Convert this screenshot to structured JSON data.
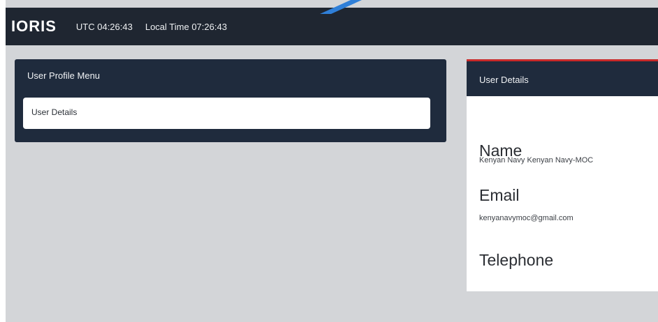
{
  "header": {
    "logo": "IORIS",
    "utc_time": "UTC 04:26:43",
    "local_time": "Local Time 07:26:43"
  },
  "user_profile_menu": {
    "title": "User Profile Menu",
    "items": [
      {
        "label": "User Details"
      }
    ]
  },
  "user_details": {
    "title": "User Details",
    "name_label": "Name",
    "name_value": "Kenyan Navy Kenyan Navy-MOC",
    "email_label": "Email",
    "email_value": "kenyanavymoc@gmail.com",
    "telephone_label": "Telephone"
  },
  "colors": {
    "topbar": "#1f2631",
    "panel_header": "#1f2b3d",
    "page_background": "#d3d5d8",
    "accent_red": "#c92a2a",
    "pointer_blue": "#2f7fd8"
  }
}
